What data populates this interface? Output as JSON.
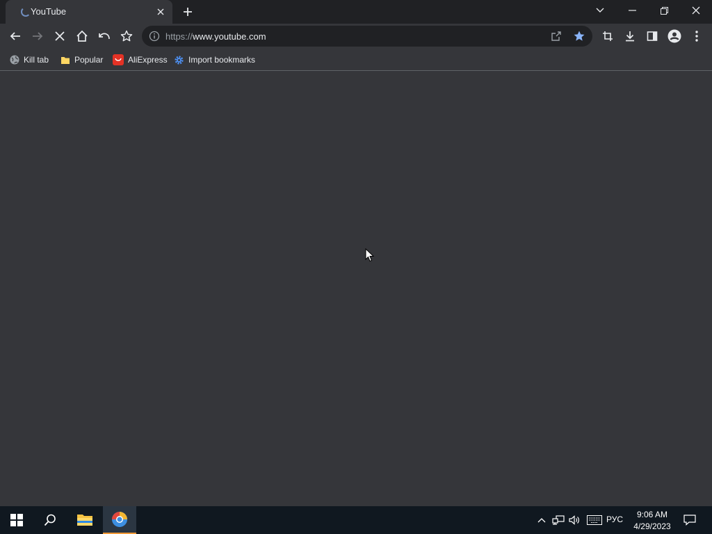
{
  "browser": {
    "tab": {
      "title": "YouTube",
      "loading": true
    },
    "address": {
      "scheme": "https://",
      "host": "www.youtube.com"
    },
    "bookmarks": [
      {
        "label": "Kill tab",
        "icon": "globe-icon"
      },
      {
        "label": "Popular",
        "icon": "folder-icon"
      },
      {
        "label": "AliExpress",
        "icon": "aliexpress-icon"
      },
      {
        "label": "Import bookmarks",
        "icon": "gear-icon"
      }
    ]
  },
  "taskbar": {
    "language": "РУС",
    "time": "9:06 AM",
    "date": "4/29/2023"
  },
  "colors": {
    "accent": "#8ab4f8",
    "frame": "#202124",
    "toolbar": "#35363a",
    "taskbar": "#101820",
    "active_indicator": "#f29a38"
  }
}
